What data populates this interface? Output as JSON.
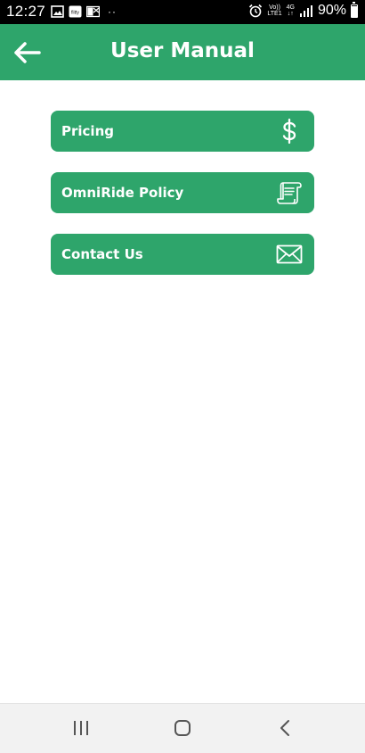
{
  "status_bar": {
    "time": "12:27",
    "left_icons": [
      "image-icon",
      "flitty-icon",
      "outlook-icon"
    ],
    "dots": "··",
    "network_top": "Vo))",
    "network_bottom": "LTE1",
    "data_top": "4G",
    "data_bottom": "↓↑",
    "battery": "90%"
  },
  "app_bar": {
    "title": "User Manual",
    "back_icon": "arrow-left-icon"
  },
  "menu": {
    "items": [
      {
        "label": "Pricing",
        "icon": "dollar-icon"
      },
      {
        "label": "OmniRide Policy",
        "icon": "scroll-document-icon"
      },
      {
        "label": "Contact Us",
        "icon": "envelope-icon"
      }
    ]
  },
  "colors": {
    "primary": "#2ea56b",
    "on_primary": "#ffffff",
    "background": "#ffffff",
    "status_bar": "#000000",
    "nav_bar": "#f2f2f2"
  },
  "nav_bar": {
    "buttons": [
      "recent-apps-icon",
      "home-icon",
      "back-chevron-icon"
    ]
  }
}
